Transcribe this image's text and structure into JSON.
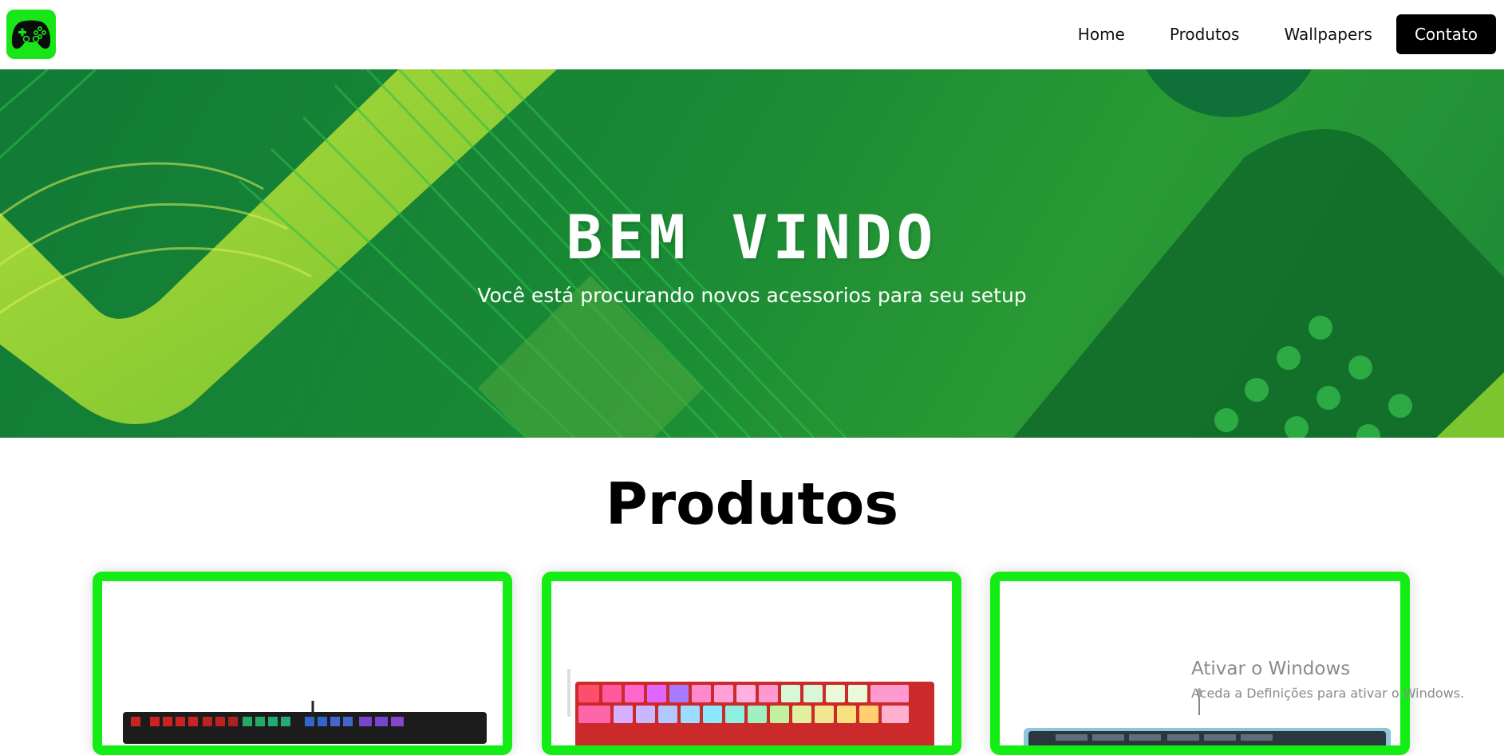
{
  "nav": {
    "logo_icon": "gamepad-icon",
    "links": [
      "Home",
      "Produtos",
      "Wallpapers"
    ],
    "contact": "Contato"
  },
  "hero": {
    "title": "BEM VINDO",
    "subtitle": "Você está procurando novos acessorios para seu setup"
  },
  "products": {
    "title": "Produtos"
  },
  "colors": {
    "accent": "#13ed13",
    "hero_green": "#1a8a35"
  },
  "watermark": {
    "title": "Ativar o Windows",
    "subtitle": "Aceda a Definições para ativar o Windows."
  }
}
